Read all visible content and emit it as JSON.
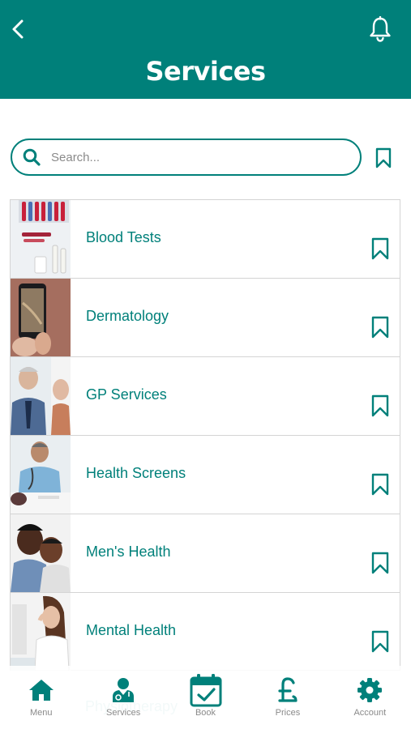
{
  "header": {
    "title": "Services",
    "back_icon": "chevron-left-icon",
    "notification_icon": "bell-icon",
    "background_color": "#00807a"
  },
  "search": {
    "placeholder": "Search...",
    "value": "",
    "icon": "search-icon",
    "saved_filter_icon": "bookmark-icon"
  },
  "services": [
    {
      "label": "Blood Tests",
      "image": "blood-tests-photo",
      "bookmark_icon": "bookmark-icon"
    },
    {
      "label": "Dermatology",
      "image": "dermatology-photo",
      "bookmark_icon": "bookmark-icon"
    },
    {
      "label": "GP Services",
      "image": "gp-services-photo",
      "bookmark_icon": "bookmark-icon"
    },
    {
      "label": "Health Screens",
      "image": "health-screens-photo",
      "bookmark_icon": "bookmark-icon"
    },
    {
      "label": "Men's Health",
      "image": "mens-health-photo",
      "bookmark_icon": "bookmark-icon"
    },
    {
      "label": "Mental Health",
      "image": "mental-health-photo",
      "bookmark_icon": "bookmark-icon"
    }
  ],
  "partially_visible_service": {
    "label": "Physiotherapy"
  },
  "bottom_nav": [
    {
      "label": "Menu",
      "icon": "home-icon"
    },
    {
      "label": "Services",
      "icon": "doctor-icon"
    },
    {
      "label": "Book",
      "icon": "calendar-check-icon"
    },
    {
      "label": "Prices",
      "icon": "pound-icon"
    },
    {
      "label": "Account",
      "icon": "gear-icon"
    }
  ],
  "colors": {
    "accent": "#00807a",
    "label_text": "#00807a",
    "nav_label": "#8a8a8a",
    "divider": "#d4d4d4"
  }
}
